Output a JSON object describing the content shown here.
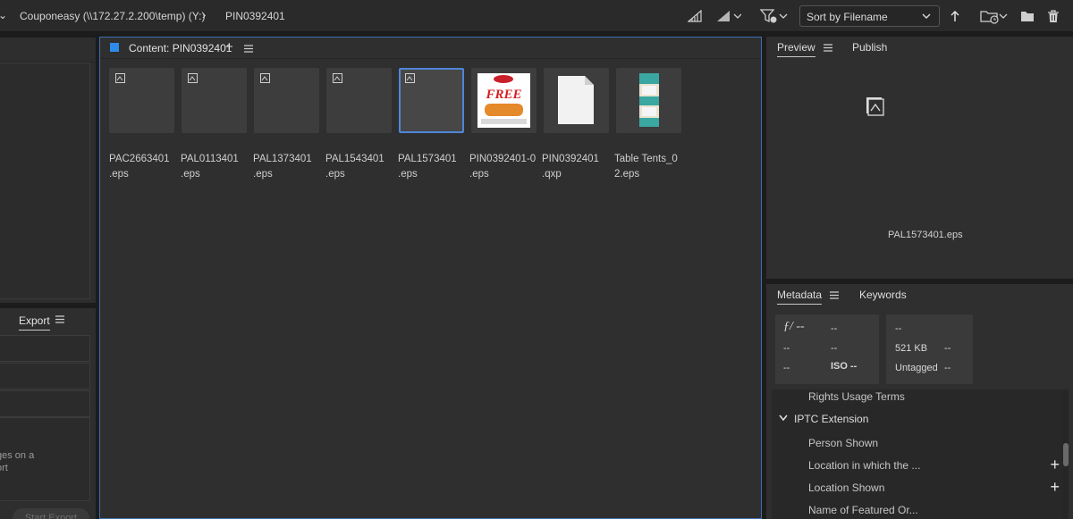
{
  "breadcrumb": {
    "drive": "Couponeasy (\\\\172.27.2.200\\temp) (Y:)",
    "folder": "PIN0392401"
  },
  "toolbar": {
    "sort_label": "Sort by Filename"
  },
  "content": {
    "title": "Content: PIN0392401",
    "files": [
      {
        "name": "PAC2663401.eps",
        "line1": "PAC2663401",
        "line2": ".eps",
        "thumb": "placeholder"
      },
      {
        "name": "PAL0113401.eps",
        "line1": "PAL0113401",
        "line2": ".eps",
        "thumb": "placeholder"
      },
      {
        "name": "PAL1373401.eps",
        "line1": "PAL1373401",
        "line2": ".eps",
        "thumb": "placeholder"
      },
      {
        "name": "PAL1543401.eps",
        "line1": "PAL1543401",
        "line2": ".eps",
        "thumb": "placeholder"
      },
      {
        "name": "PAL1573401.eps",
        "line1": "PAL1573401",
        "line2": ".eps",
        "thumb": "placeholder",
        "selected": true
      },
      {
        "name": "PIN0392401-0.eps",
        "line1": "PIN0392401-0",
        "line2": ".eps",
        "thumb": "coupon",
        "thumb_text": "FREE"
      },
      {
        "name": "PIN0392401.qxp",
        "line1": "PIN0392401",
        "line2": ".qxp",
        "thumb": "document"
      },
      {
        "name": "Table Tents_02.eps",
        "line1": "Table Tents_0",
        "line2": "2.eps",
        "thumb": "tent"
      }
    ]
  },
  "left_panel": {
    "export_tab": "Export",
    "hint_text_1": "ges on a",
    "hint_text_2": "ort",
    "start_export": "Start Export"
  },
  "preview": {
    "tab_preview": "Preview",
    "tab_publish": "Publish",
    "filename": "PAL1573401.eps"
  },
  "metadata": {
    "tab_metadata": "Metadata",
    "tab_keywords": "Keywords",
    "box1": {
      "aperture": "ƒ/ --",
      "v2": "--",
      "v3": "--",
      "v4": "--",
      "v5": "--",
      "iso": "ISO --"
    },
    "box2": {
      "v1": "--",
      "size": "521 KB",
      "v3": "--",
      "tag": "Untagged",
      "v5": "--"
    },
    "rows": {
      "rights": "Rights Usage Terms",
      "section": "IPTC Extension",
      "person": "Person Shown",
      "location_in": "Location in which the ...",
      "location_shown": "Location Shown",
      "featured": "Name of Featured Or..."
    }
  },
  "colors": {
    "accent": "#2d8ceb",
    "selection_border": "#4f86d9",
    "panel_bg": "#2f2f2f"
  }
}
